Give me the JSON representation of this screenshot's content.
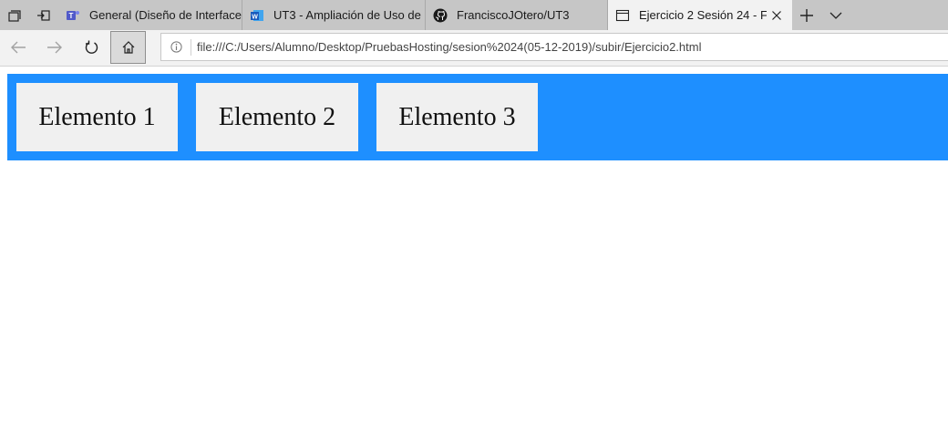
{
  "tabstrip": {
    "tabs": [
      {
        "label": "General (Diseño de Interfaces",
        "icon": "teams-icon",
        "active": false
      },
      {
        "label": "UT3 - Ampliación de Uso de",
        "icon": "word-icon",
        "active": false
      },
      {
        "label": "FranciscoJOtero/UT3",
        "icon": "github-icon",
        "active": false
      },
      {
        "label": "Ejercicio 2 Sesión 24 - F",
        "icon": "page-icon",
        "active": true
      }
    ],
    "new_tab": "+",
    "colors": {
      "strip": "#c6c6c6",
      "active_tab": "#f2f2f2"
    }
  },
  "navbar": {
    "url": "file:///C:/Users/Alumno/Desktop/PruebasHosting/sesion%2024(05-12-2019)/subir/Ejercicio2.html"
  },
  "page": {
    "menu_color": "#1e8fff",
    "items": [
      {
        "label": "Elemento 1"
      },
      {
        "label": "Elemento 2"
      },
      {
        "label": "Elemento 3"
      }
    ]
  }
}
